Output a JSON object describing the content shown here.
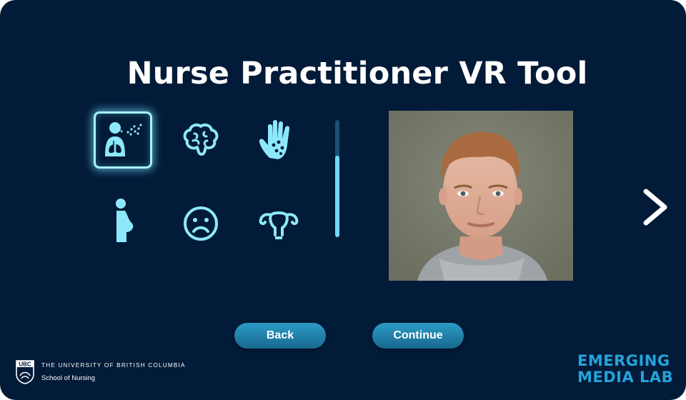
{
  "header": {
    "title": "Nurse Practitioner VR Tool"
  },
  "categories": [
    {
      "icon": "respiratory-icon",
      "selected": true
    },
    {
      "icon": "brain-icon",
      "selected": false
    },
    {
      "icon": "skin-rash-hand-icon",
      "selected": false
    },
    {
      "icon": "pregnancy-icon",
      "selected": false
    },
    {
      "icon": "sad-face-icon",
      "selected": false
    },
    {
      "icon": "uterus-icon",
      "selected": false
    }
  ],
  "patient": {
    "portrait": "patient-portrait-young-man-grey-hoodie"
  },
  "navigation": {
    "next_icon": "chevron-right-icon"
  },
  "buttons": {
    "back_label": "Back",
    "continue_label": "Continue"
  },
  "footer": {
    "ubc_logo_text": "UBC",
    "university": "THE UNIVERSITY OF BRITISH COLUMBIA",
    "school": "School of Nursing",
    "lab_line1": "EMERGING",
    "lab_line2": "MEDIA LAB"
  },
  "colors": {
    "background": "#021b38",
    "icon": "#8ee8fb",
    "button": "#1f86b3",
    "lab_logo": "#24a3da"
  }
}
